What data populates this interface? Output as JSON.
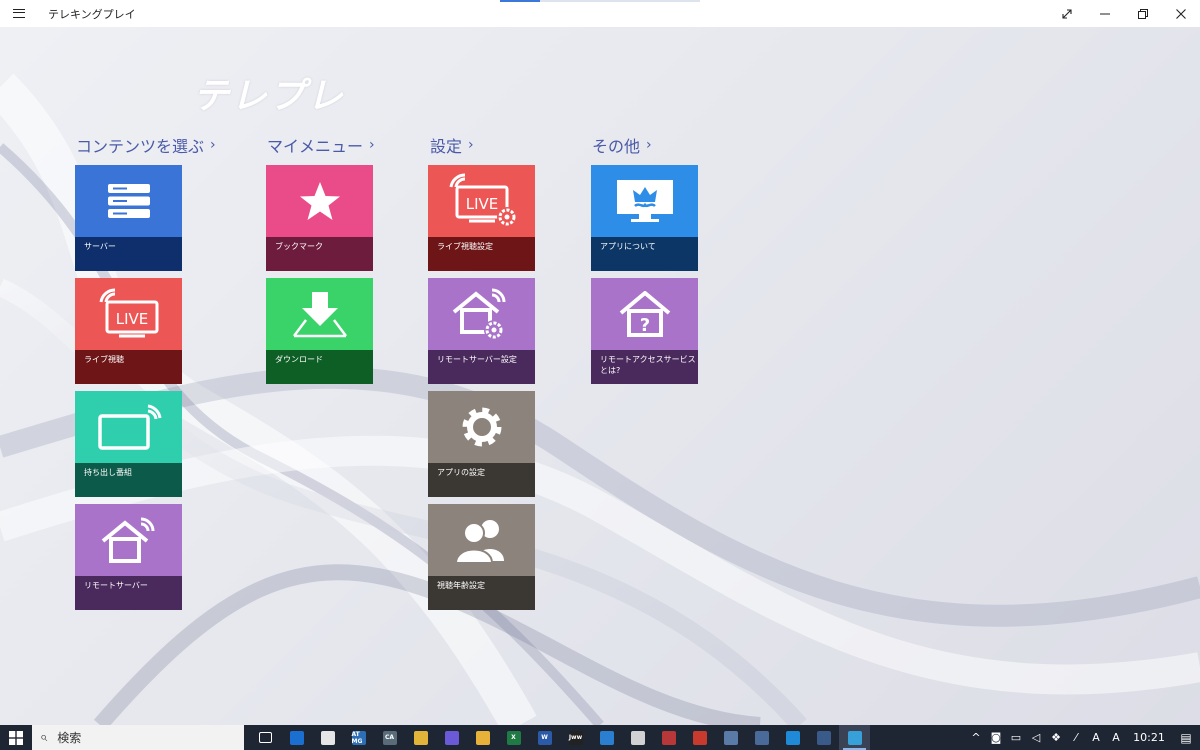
{
  "app": {
    "title": "テレキングプレイ",
    "logo": "テレプレ"
  },
  "groups": [
    {
      "title": "コンテンツを選ぶ"
    },
    {
      "title": "マイメニュー"
    },
    {
      "title": "設定"
    },
    {
      "title": "その他"
    }
  ],
  "tiles": {
    "server": {
      "label": "サーバー",
      "icon": "server-icon",
      "color": "#3a74d6",
      "band": "#0e2f6b"
    },
    "live": {
      "label": "ライブ視聴",
      "icon": "live-tv-icon",
      "color": "#ec5654",
      "band": "#6e1617"
    },
    "takeout": {
      "label": "持ち出し番組",
      "icon": "tablet-wifi-icon",
      "color": "#2fcfae",
      "band": "#0c5a49"
    },
    "remote_server": {
      "label": "リモートサーバー",
      "icon": "home-wifi-icon",
      "color": "#a873c8",
      "band": "#4a2a5d"
    },
    "bookmark": {
      "label": "ブックマーク",
      "icon": "star-icon",
      "color": "#ea4c8a",
      "band": "#6e1c3d"
    },
    "download": {
      "label": "ダウンロード",
      "icon": "download-icon",
      "color": "#3ad36a",
      "band": "#0e5f26"
    },
    "live_settings": {
      "label": "ライブ視聴設定",
      "icon": "live-tv-gear-icon",
      "color": "#ec5654",
      "band": "#6e1617"
    },
    "remote_server_settings": {
      "label": "リモートサーバー設定",
      "icon": "home-wifi-gear-icon",
      "color": "#a873c8",
      "band": "#4a2a5d"
    },
    "app_settings": {
      "label": "アプリの設定",
      "icon": "gear-icon",
      "color": "#8c847c",
      "band": "#3b3733"
    },
    "age_settings": {
      "label": "視聴年齢設定",
      "icon": "users-icon",
      "color": "#8c847c",
      "band": "#3b3733"
    },
    "about": {
      "label": "アプリについて",
      "icon": "crown-monitor-icon",
      "color": "#2e8de6",
      "band": "#0c3666"
    },
    "remote_access": {
      "label": "リモートアクセスサービスとは?",
      "icon": "home-question-icon",
      "color": "#a873c8",
      "band": "#4a2a5d"
    }
  },
  "taskbar": {
    "search_placeholder": "検索",
    "apps": [
      {
        "name": "task-view",
        "text": "",
        "color": "#1e2533"
      },
      {
        "name": "edge",
        "text": "",
        "color": "#1b6fd1"
      },
      {
        "name": "app-2",
        "text": "",
        "color": "#e6e6e6"
      },
      {
        "name": "atmg",
        "text": "AT MG",
        "color": "#2d6fb6"
      },
      {
        "name": "ca",
        "text": "CA",
        "color": "#5a6c7a"
      },
      {
        "name": "chrome",
        "text": "",
        "color": "#e2b53a"
      },
      {
        "name": "app-6",
        "text": "",
        "color": "#6b5ad8"
      },
      {
        "name": "explorer",
        "text": "",
        "color": "#e8b23a"
      },
      {
        "name": "excel",
        "text": "X",
        "color": "#1f7a43"
      },
      {
        "name": "word",
        "text": "W",
        "color": "#2b5aa8"
      },
      {
        "name": "jww",
        "text": "Jww",
        "color": "#222222"
      },
      {
        "name": "app-11",
        "text": "",
        "color": "#2a7fd0"
      },
      {
        "name": "app-12",
        "text": "",
        "color": "#d2d2d2"
      },
      {
        "name": "app-13",
        "text": "",
        "color": "#b8383a"
      },
      {
        "name": "acrobat",
        "text": "",
        "color": "#c83a2e"
      },
      {
        "name": "app-15",
        "text": "",
        "color": "#5a7aa8"
      },
      {
        "name": "app-16",
        "text": "",
        "color": "#4a6a9a"
      },
      {
        "name": "edge-2",
        "text": "",
        "color": "#1f8ad8"
      },
      {
        "name": "defender",
        "text": "",
        "color": "#3a5a8a"
      },
      {
        "name": "teleplay",
        "text": "",
        "color": "#37a0d8",
        "active": true
      }
    ],
    "clock": "10:21"
  }
}
